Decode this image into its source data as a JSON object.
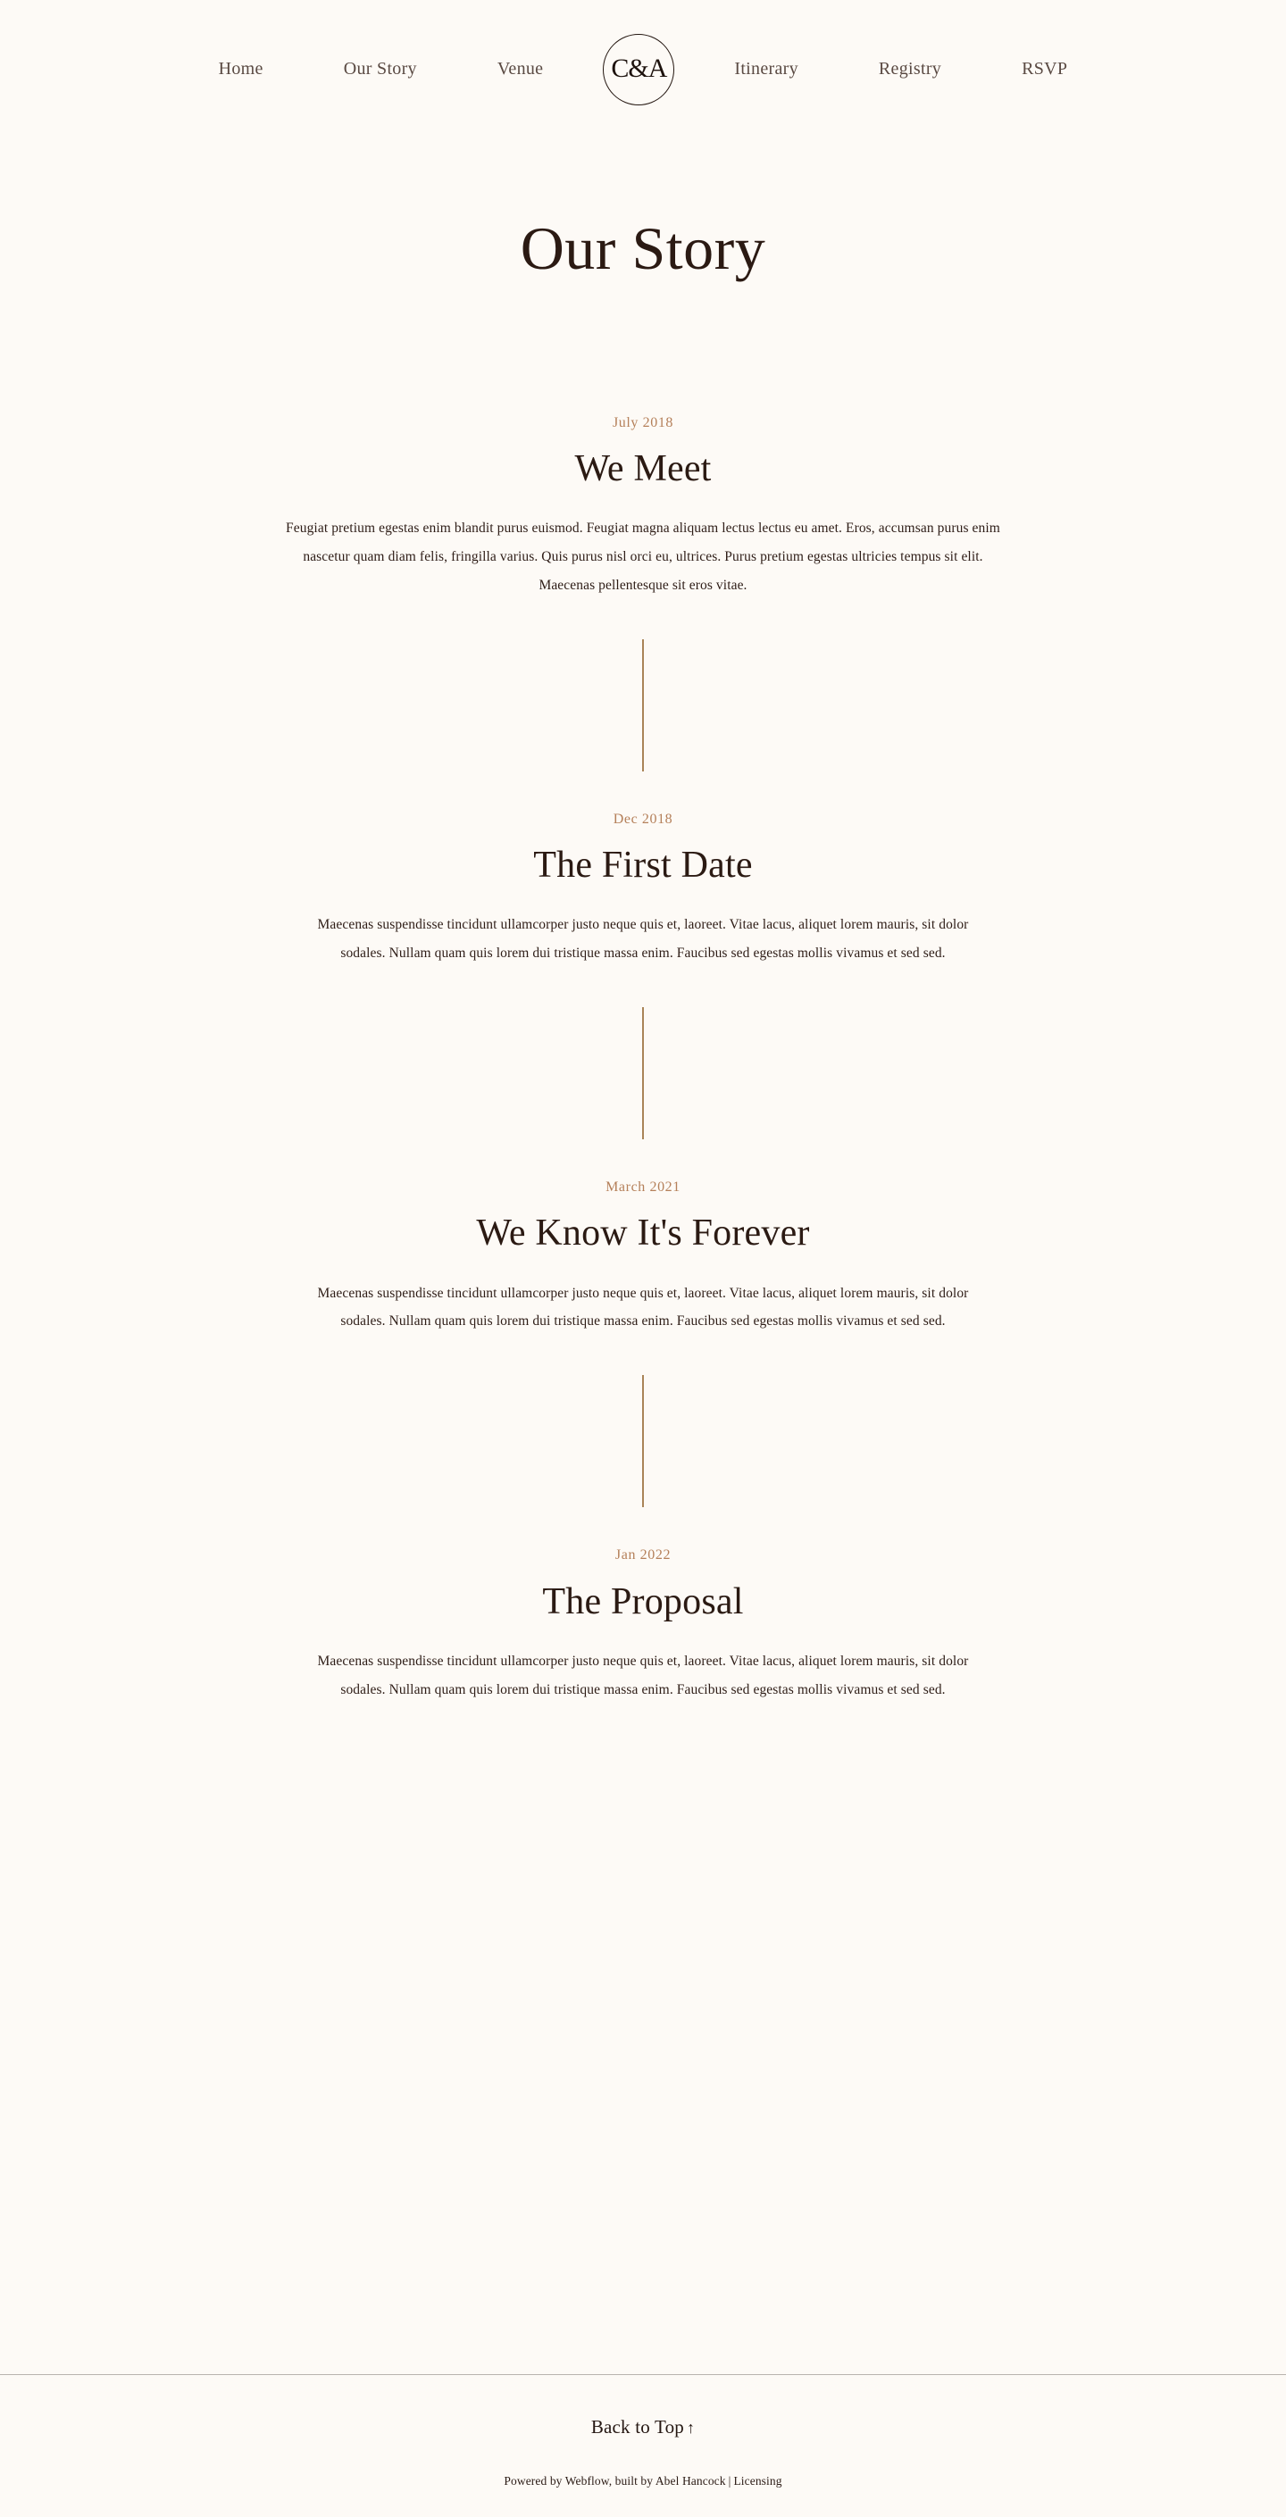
{
  "theme": {
    "background": "#fdfaf6",
    "text_dark": "#2b1a13",
    "accent_tan": "#b5805a",
    "divider_line": "#a98457",
    "footer_rule": "#b9b3ae"
  },
  "nav": {
    "logo": {
      "monogram": "C&A",
      "icon": "circle-monogram-logo"
    },
    "left_items": [
      {
        "label": "Home"
      },
      {
        "label": "Our Story"
      },
      {
        "label": "Venue"
      }
    ],
    "right_items": [
      {
        "label": "Itinerary"
      },
      {
        "label": "Registry"
      },
      {
        "label": "RSVP"
      }
    ]
  },
  "hero": {
    "title": "Our Story"
  },
  "timeline": {
    "entries": [
      {
        "date": "July 2018",
        "heading": "We Meet",
        "body": "Feugiat pretium egestas enim blandit purus euismod. Feugiat magna aliquam lectus lectus eu amet. Eros, accumsan purus enim nascetur quam diam felis, fringilla varius. Quis purus nisl orci eu, ultrices. Purus pretium egestas ultricies tempus sit elit. Maecenas pellentesque sit eros vitae."
      },
      {
        "date": "Dec 2018",
        "heading": "The First Date",
        "body": "Maecenas suspendisse tincidunt ullamcorper justo neque quis et, laoreet. Vitae lacus, aliquet lorem mauris, sit dolor sodales. Nullam quam quis lorem dui tristique massa enim. Faucibus sed egestas mollis vivamus et sed sed."
      },
      {
        "date": "March 2021",
        "heading": "We Know It's Forever",
        "body": "Maecenas suspendisse tincidunt ullamcorper justo neque quis et, laoreet. Vitae lacus, aliquet lorem mauris, sit dolor sodales. Nullam quam quis lorem dui tristique massa enim. Faucibus sed egestas mollis vivamus et sed sed."
      },
      {
        "date": "Jan 2022",
        "heading": "The Proposal",
        "body": "Maecenas suspendisse tincidunt ullamcorper justo neque quis et, laoreet. Vitae lacus, aliquet lorem mauris, sit dolor sodales. Nullam quam quis lorem dui tristique massa enim. Faucibus sed egestas mollis vivamus et sed sed."
      }
    ]
  },
  "footer": {
    "back_to_top_label": "Back to Top",
    "back_to_top_arrow": "↑",
    "credit_prefix": "Powered by Webflow, built by Abel Hancock",
    "credit_separator": "|",
    "credit_link": "Licensing"
  }
}
